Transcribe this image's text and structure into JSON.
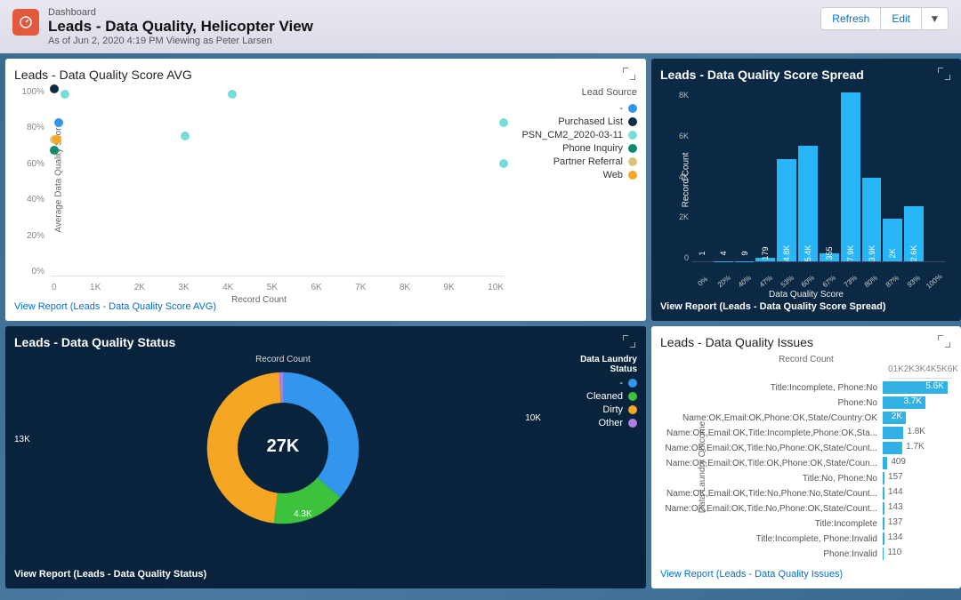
{
  "header": {
    "eyebrow": "Dashboard",
    "title": "Leads - Data Quality, Helicopter View",
    "subtitle": "As of Jun 2, 2020 4:19 PM Viewing as Peter Larsen",
    "refresh": "Refresh",
    "edit": "Edit"
  },
  "colors": {
    "dash": "#3296ed",
    "purchased": "#0d2a44",
    "psn": "#78dcd8",
    "phone": "#0e8a6e",
    "partner": "#d6c77a",
    "web": "#f5a623",
    "dirty": "#f5a623",
    "cleaned": "#3cc23c",
    "other": "#b07de3",
    "darkbar": "#29b6f6"
  },
  "scatter": {
    "title": "Leads - Data Quality Score AVG",
    "legend_title": "Lead Source",
    "legend": [
      {
        "label": "-",
        "color": "#3296ed"
      },
      {
        "label": "Purchased List",
        "color": "#0d2a44"
      },
      {
        "label": "PSN_CM2_2020-03-11",
        "color": "#78dcd8"
      },
      {
        "label": "Phone Inquiry",
        "color": "#0e8a6e"
      },
      {
        "label": "Partner Referral",
        "color": "#d6c77a"
      },
      {
        "label": "Web",
        "color": "#f5a623"
      }
    ],
    "report": "View Report (Leads - Data Quality Score AVG)",
    "yTicks": [
      "100%",
      "80%",
      "60%",
      "40%",
      "20%",
      "0%"
    ],
    "xTicks": [
      "0",
      "1K",
      "2K",
      "3K",
      "4K",
      "5K",
      "6K",
      "7K",
      "8K",
      "9K",
      "10K"
    ],
    "ylabel": "Average Data Quality Score",
    "xlabel": "Record Count"
  },
  "spread": {
    "title": "Leads - Data Quality Score Spread",
    "report": "View Report (Leads - Data Quality Score Spread)",
    "ylabel": "Record Count",
    "xlabel": "Data Quality Score",
    "yTicks": [
      "8K",
      "6K",
      "4K",
      "2K",
      "0"
    ]
  },
  "donut": {
    "title": "Leads - Data Quality Status",
    "subtitle": "Record Count",
    "legend_title": "Data Laundry Status",
    "center": "27K",
    "report": "View Report (Leads - Data Quality Status)",
    "legend": [
      {
        "label": "-",
        "color": "#3296ed"
      },
      {
        "label": "Cleaned",
        "color": "#3cc23c"
      },
      {
        "label": "Dirty",
        "color": "#f5a623"
      },
      {
        "label": "Other",
        "color": "#b07de3"
      }
    ],
    "labels": {
      "a": "10K",
      "b": "4.3K",
      "c": "13K"
    }
  },
  "issues": {
    "title": "Leads - Data Quality Issues",
    "report": "View Report (Leads - Data Quality Issues)",
    "axis_title": "Record Count",
    "ticks": [
      "0",
      "1K",
      "2K",
      "3K",
      "4K",
      "5K",
      "6K"
    ],
    "ylabel": "Data Laundry Outcome"
  },
  "chart_data": [
    {
      "type": "scatter",
      "title": "Leads - Data Quality Score AVG",
      "xlabel": "Record Count",
      "ylabel": "Average Data Quality Score",
      "xlim": [
        0,
        10000
      ],
      "ylim": [
        0,
        100
      ],
      "series": [
        {
          "name": "-",
          "color": "#3296ed",
          "points": [
            [
              150,
              82
            ]
          ]
        },
        {
          "name": "Purchased List",
          "color": "#0d2a44",
          "points": [
            [
              50,
              100
            ]
          ]
        },
        {
          "name": "PSN_CM2_2020-03-11",
          "color": "#78dcd8",
          "points": [
            [
              300,
              97
            ],
            [
              2950,
              75
            ],
            [
              4000,
              97
            ],
            [
              10000,
              82
            ],
            [
              10000,
              60
            ]
          ]
        },
        {
          "name": "Phone Inquiry",
          "color": "#0e8a6e",
          "points": [
            [
              50,
              67
            ]
          ]
        },
        {
          "name": "Partner Referral",
          "color": "#d6c77a",
          "points": [
            [
              50,
              73
            ]
          ]
        },
        {
          "name": "Web",
          "color": "#f5a623",
          "points": [
            [
              120,
              73
            ]
          ]
        }
      ]
    },
    {
      "type": "bar",
      "title": "Leads - Data Quality Score Spread",
      "xlabel": "Data Quality Score",
      "ylabel": "Record Count",
      "ylim": [
        0,
        8000
      ],
      "categories": [
        "0%",
        "20%",
        "40%",
        "47%",
        "53%",
        "60%",
        "67%",
        "73%",
        "80%",
        "87%",
        "93%",
        "100%"
      ],
      "values": [
        1,
        4,
        9,
        179,
        4800,
        5400,
        355,
        7900,
        3900,
        2000,
        2600,
        0
      ],
      "value_labels": [
        "1",
        "4",
        "9",
        "179",
        "4.8K",
        "5.4K",
        "355",
        "7.9K",
        "3.9K",
        "2K",
        "2.6K",
        ""
      ]
    },
    {
      "type": "pie",
      "title": "Leads - Data Quality Status",
      "total_label": "27K",
      "slices": [
        {
          "name": "-",
          "value": 10000,
          "label": "10K",
          "color": "#3296ed"
        },
        {
          "name": "Cleaned",
          "value": 4300,
          "label": "4.3K",
          "color": "#3cc23c"
        },
        {
          "name": "Dirty",
          "value": 13000,
          "label": "13K",
          "color": "#f5a623"
        },
        {
          "name": "Other",
          "value": 200,
          "color": "#b07de3"
        }
      ]
    },
    {
      "type": "bar",
      "orientation": "horizontal",
      "title": "Leads - Data Quality Issues",
      "xlabel": "Record Count",
      "xlim": [
        0,
        6000
      ],
      "ylabel": "Data Laundry Outcome",
      "categories": [
        "Title:Incomplete, Phone:No",
        "Phone:No",
        "Name:OK,Email:OK,Phone:OK,State/Country:OK",
        "Name:OK,Email:OK,Title:Incomplete,Phone:OK,Sta...",
        "Name:OK,Email:OK,Title:No,Phone:OK,State/Count...",
        "Name:OK,Email:OK,Title:OK,Phone:OK,State/Coun...",
        "Title:No, Phone:No",
        "Name:OK,Email:OK,Title:No,Phone:No,State/Count...",
        "Name:OK,Email:OK,Title:No,Phone:OK,State/Count...",
        "Title:Incomplete",
        "Title:Incomplete, Phone:Invalid",
        "Phone:Invalid"
      ],
      "values": [
        5600,
        3700,
        2000,
        1800,
        1700,
        409,
        157,
        144,
        143,
        137,
        134,
        110
      ],
      "value_labels": [
        "5.6K",
        "3.7K",
        "2K",
        "1.8K",
        "1.7K",
        "409",
        "157",
        "144",
        "143",
        "137",
        "134",
        "110"
      ]
    }
  ]
}
